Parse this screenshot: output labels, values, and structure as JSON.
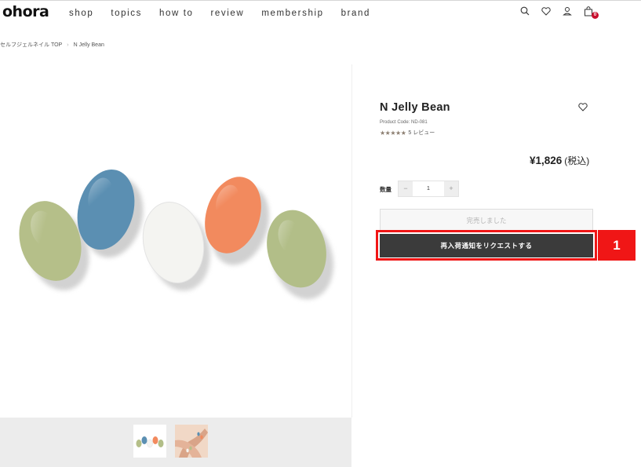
{
  "header": {
    "logo": "ohora",
    "nav": [
      "shop",
      "topics",
      "how to",
      "review",
      "membership",
      "brand"
    ],
    "icons": [
      "search-icon",
      "heart-icon",
      "user-icon",
      "cart-icon"
    ],
    "cart_count": "0"
  },
  "breadcrumb": {
    "home": "セルフジェルネイル TOP",
    "separator": "›",
    "current": "N Jelly Bean"
  },
  "product": {
    "title": "N Jelly Bean",
    "code": "Product Code: ND-081",
    "stars": "★★★★★",
    "reviews": "5 レビュー",
    "price": "¥1,826",
    "tax": "(税込)",
    "qty_label": "数量",
    "qty_minus": "−",
    "qty_value": "1",
    "qty_plus": "+",
    "soldout": "完売しました",
    "notify": "再入荷通知をリクエストする",
    "nail_colors": [
      "#b5bf89",
      "#5b8fb2",
      "#f4f4f1",
      "#f28a5e",
      "#b2be88"
    ]
  },
  "annotation": {
    "label": "1",
    "color": "#f01616"
  }
}
